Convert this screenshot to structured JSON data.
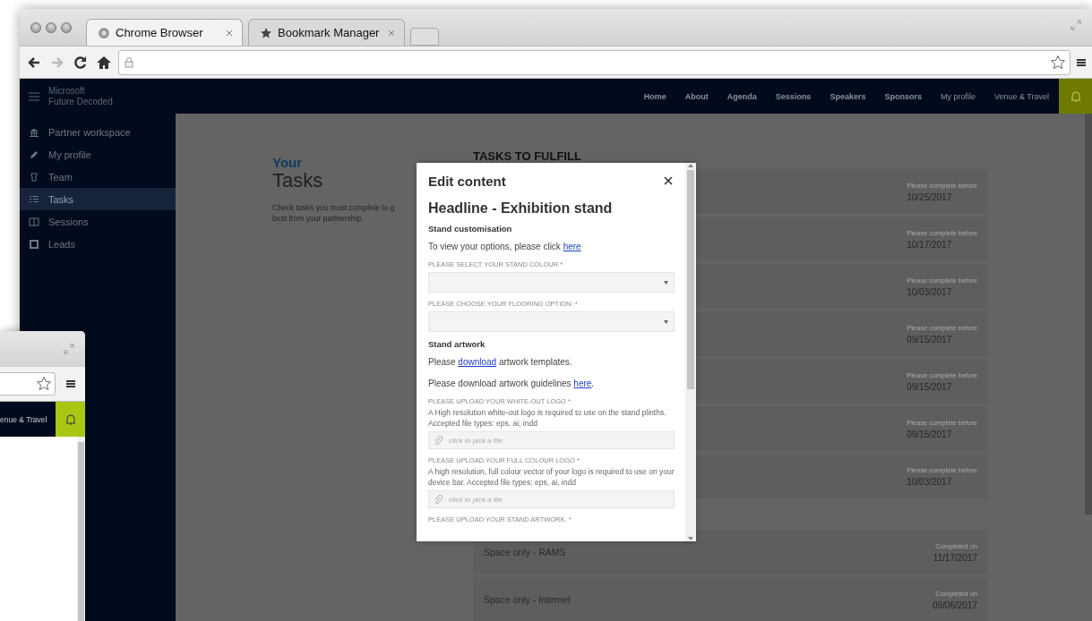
{
  "browser": {
    "tabs": [
      {
        "title": "Chrome Browser",
        "selected": true
      },
      {
        "title": "Bookmark Manager",
        "selected": false
      }
    ]
  },
  "site": {
    "brand": [
      "Microsoft",
      "Future Decoded"
    ],
    "nav": [
      {
        "label": "Home",
        "bold": true
      },
      {
        "label": "About",
        "bold": true
      },
      {
        "label": "Agenda",
        "bold": true
      },
      {
        "label": "Sessions",
        "bold": true
      },
      {
        "label": "Speakers",
        "bold": true
      },
      {
        "label": "Sponsors",
        "bold": true
      },
      {
        "label": "My profile",
        "bold": false
      },
      {
        "label": "Venue & Travel",
        "bold": false
      }
    ]
  },
  "sidebar": {
    "items": [
      {
        "label": "Partner workspace",
        "selected": false
      },
      {
        "label": "My profile",
        "selected": false
      },
      {
        "label": "Team",
        "selected": false
      },
      {
        "label": "Tasks",
        "selected": true
      },
      {
        "label": "Sessions",
        "selected": false
      },
      {
        "label": "Leads",
        "selected": false
      }
    ]
  },
  "page": {
    "kicker": "Your",
    "title": "Tasks",
    "description": [
      "Check tasks you must complete to g",
      "best from your partnership."
    ]
  },
  "tasks": {
    "title": "TASKS TO FULFILL",
    "rows": [
      {
        "kind": "pending",
        "label": "Please complete before",
        "date": "10/25/2017"
      },
      {
        "kind": "pending",
        "label": "Please complete before",
        "date": "10/17/2017"
      },
      {
        "kind": "pending",
        "label": "Please complete before",
        "date": "10/03/2017"
      },
      {
        "kind": "pending",
        "label": "Please complete before",
        "date": "09/15/2017"
      },
      {
        "kind": "pending",
        "label": "Please complete before",
        "date": "09/15/2017"
      },
      {
        "kind": "pending",
        "label": "Please complete before",
        "date": "09/15/2017"
      },
      {
        "kind": "pending",
        "label": "Please complete before",
        "date": "10/03/2017"
      },
      {
        "kind": "completed",
        "title": "Space only - RAMS",
        "label": "Completed on",
        "date": "11/17/2017"
      },
      {
        "kind": "completed",
        "title": "Space only - Internet",
        "label": "Completed on",
        "date": "09/06/2017"
      }
    ]
  },
  "modal": {
    "title": "Edit content",
    "body": [
      {
        "kind": "heading",
        "text": "Headline - Exhibition stand"
      },
      {
        "kind": "subheading",
        "text": "Stand customisation"
      },
      {
        "kind": "paragraph",
        "before": "To view your options, please click ",
        "link": "here"
      },
      {
        "kind": "select",
        "label": "PLEASE SELECT YOUR STAND COLOUR *"
      },
      {
        "kind": "select",
        "label": "PLEASE CHOOSE YOUR FLOORING OPTION:  *"
      },
      {
        "kind": "subheading",
        "text": "Stand artwork"
      },
      {
        "kind": "paragraph",
        "before": "Please ",
        "link": "download",
        "after": " artwork templates."
      },
      {
        "kind": "paragraph",
        "before": "Please download artwork guidelines ",
        "link": "here",
        "after": "."
      },
      {
        "kind": "file",
        "label": "PLEASE UPLOAD YOUR WHITE-OUT LOGO *",
        "help": "A High resolution white-out logo is required to use on the stand plinths. Accepted file types: eps, ai, indd",
        "placeholder": "click to pick a file"
      },
      {
        "kind": "file",
        "label": "PLEASE UPLOAD YOUR FULL COLOUR LOGO  *",
        "help": "A high resolution, full colour vector of your logo is required to use on your device bar. Accepted file types: eps, ai, indd",
        "placeholder": "click to pick a file"
      },
      {
        "kind": "label",
        "text": "PLEASE UPLOAD YOUR STAND ARTWORK. *"
      }
    ]
  },
  "back_window": {
    "nav_label": "enue & Travel"
  }
}
